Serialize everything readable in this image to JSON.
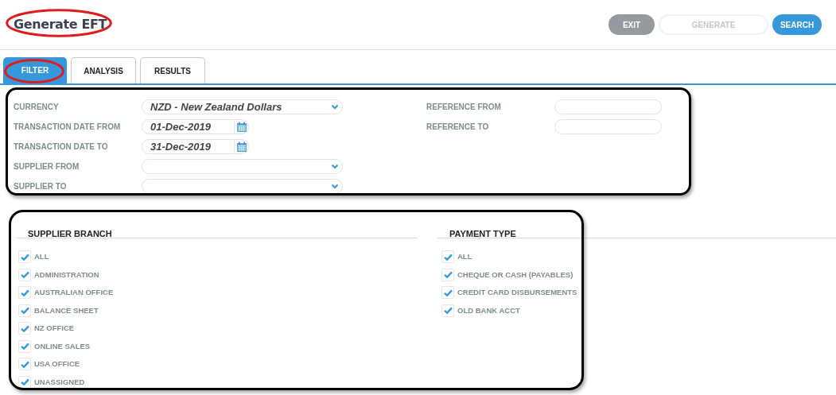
{
  "title": {
    "text": "Generate EFT",
    "circled": true
  },
  "buttons": [
    {
      "label": "EXIT",
      "kind": "exit",
      "disabled": false
    },
    {
      "label": "GENERATE",
      "kind": "generate",
      "disabled": true
    },
    {
      "label": "SEARCH",
      "kind": "search",
      "disabled": false
    }
  ],
  "tabs": [
    {
      "label": "FILTER",
      "selected": true,
      "circled": true
    },
    {
      "label": "ANALYSIS",
      "selected": false,
      "circled": false
    },
    {
      "label": "RESULTS",
      "selected": false,
      "circled": false
    }
  ],
  "filter_panel": {
    "outlined": true,
    "left_fields": [
      {
        "label": "CURRENCY",
        "kind": "dropdown",
        "value": "NZD - New Zealand Dollars"
      },
      {
        "label": "TRANSACTION DATE FROM",
        "kind": "date",
        "value": "01-Dec-2019"
      },
      {
        "label": "TRANSACTION DATE TO",
        "kind": "date",
        "value": "31-Dec-2019"
      },
      {
        "label": "SUPPLIER FROM",
        "kind": "dropdown"
      },
      {
        "label": "SUPPLIER TO",
        "kind": "dropdown"
      }
    ],
    "right_fields": [
      {
        "label": "REFERENCE FROM",
        "kind": "text"
      },
      {
        "label": "REFERENCE TO",
        "kind": "text"
      }
    ]
  },
  "checklists": {
    "outlined": true,
    "sections": [
      {
        "heading": "SUPPLIER BRANCH",
        "items": [
          {
            "label": "ALL",
            "checked": true
          },
          {
            "label": "ADMINISTRATION",
            "checked": true
          },
          {
            "label": "AUSTRALIAN OFFICE",
            "checked": true
          },
          {
            "label": "BALANCE SHEET",
            "checked": true
          },
          {
            "label": "NZ OFFICE",
            "checked": true
          },
          {
            "label": "ONLINE SALES",
            "checked": true
          },
          {
            "label": "USA OFFICE",
            "checked": true
          },
          {
            "label": "UNASSIGNED",
            "checked": true
          }
        ]
      },
      {
        "heading": "PAYMENT TYPE",
        "items": [
          {
            "label": "ALL",
            "checked": true
          },
          {
            "label": "CHEQUE OR CASH (PAYABLES)",
            "checked": true
          },
          {
            "label": "CREDIT CARD DISBURSEMENTS",
            "checked": true
          },
          {
            "label": "OLD BANK ACCT",
            "checked": true
          }
        ]
      }
    ]
  }
}
